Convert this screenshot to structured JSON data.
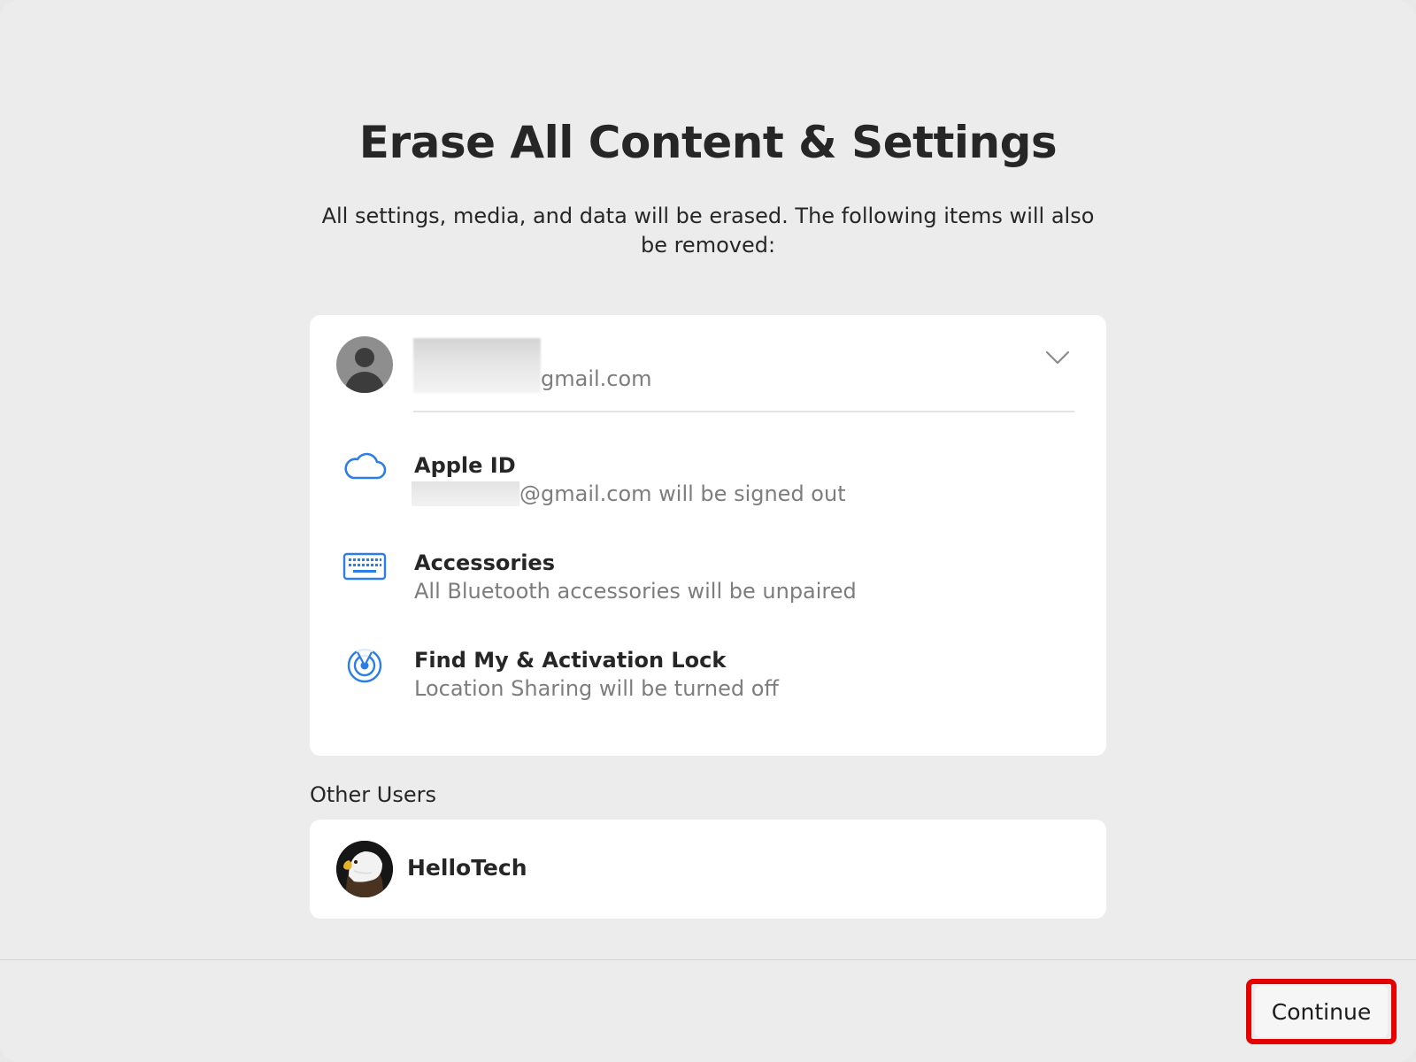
{
  "title": "Erase All Content & Settings",
  "description": "All settings, media, and data will be erased. The following items will also be removed:",
  "account": {
    "email_domain": "gmail.com",
    "avatar_icon": "person-silhouette-icon"
  },
  "items": [
    {
      "icon": "cloud-icon",
      "title": "Apple ID",
      "subtitle": "@gmail.com will be signed out"
    },
    {
      "icon": "keyboard-icon",
      "title": "Accessories",
      "subtitle": "All Bluetooth accessories will be unpaired"
    },
    {
      "icon": "find-my-icon",
      "title": "Find My & Activation Lock",
      "subtitle": "Location Sharing will be turned off"
    }
  ],
  "other_users": {
    "label": "Other Users",
    "users": [
      {
        "name": "HelloTech",
        "avatar": "eagle-photo"
      }
    ]
  },
  "footer": {
    "continue_label": "Continue"
  },
  "colors": {
    "background": "#ececec",
    "card": "#ffffff",
    "accent_icon": "#2b7de9",
    "highlight": "#e50000",
    "secondary_text": "#7d7d7d"
  }
}
